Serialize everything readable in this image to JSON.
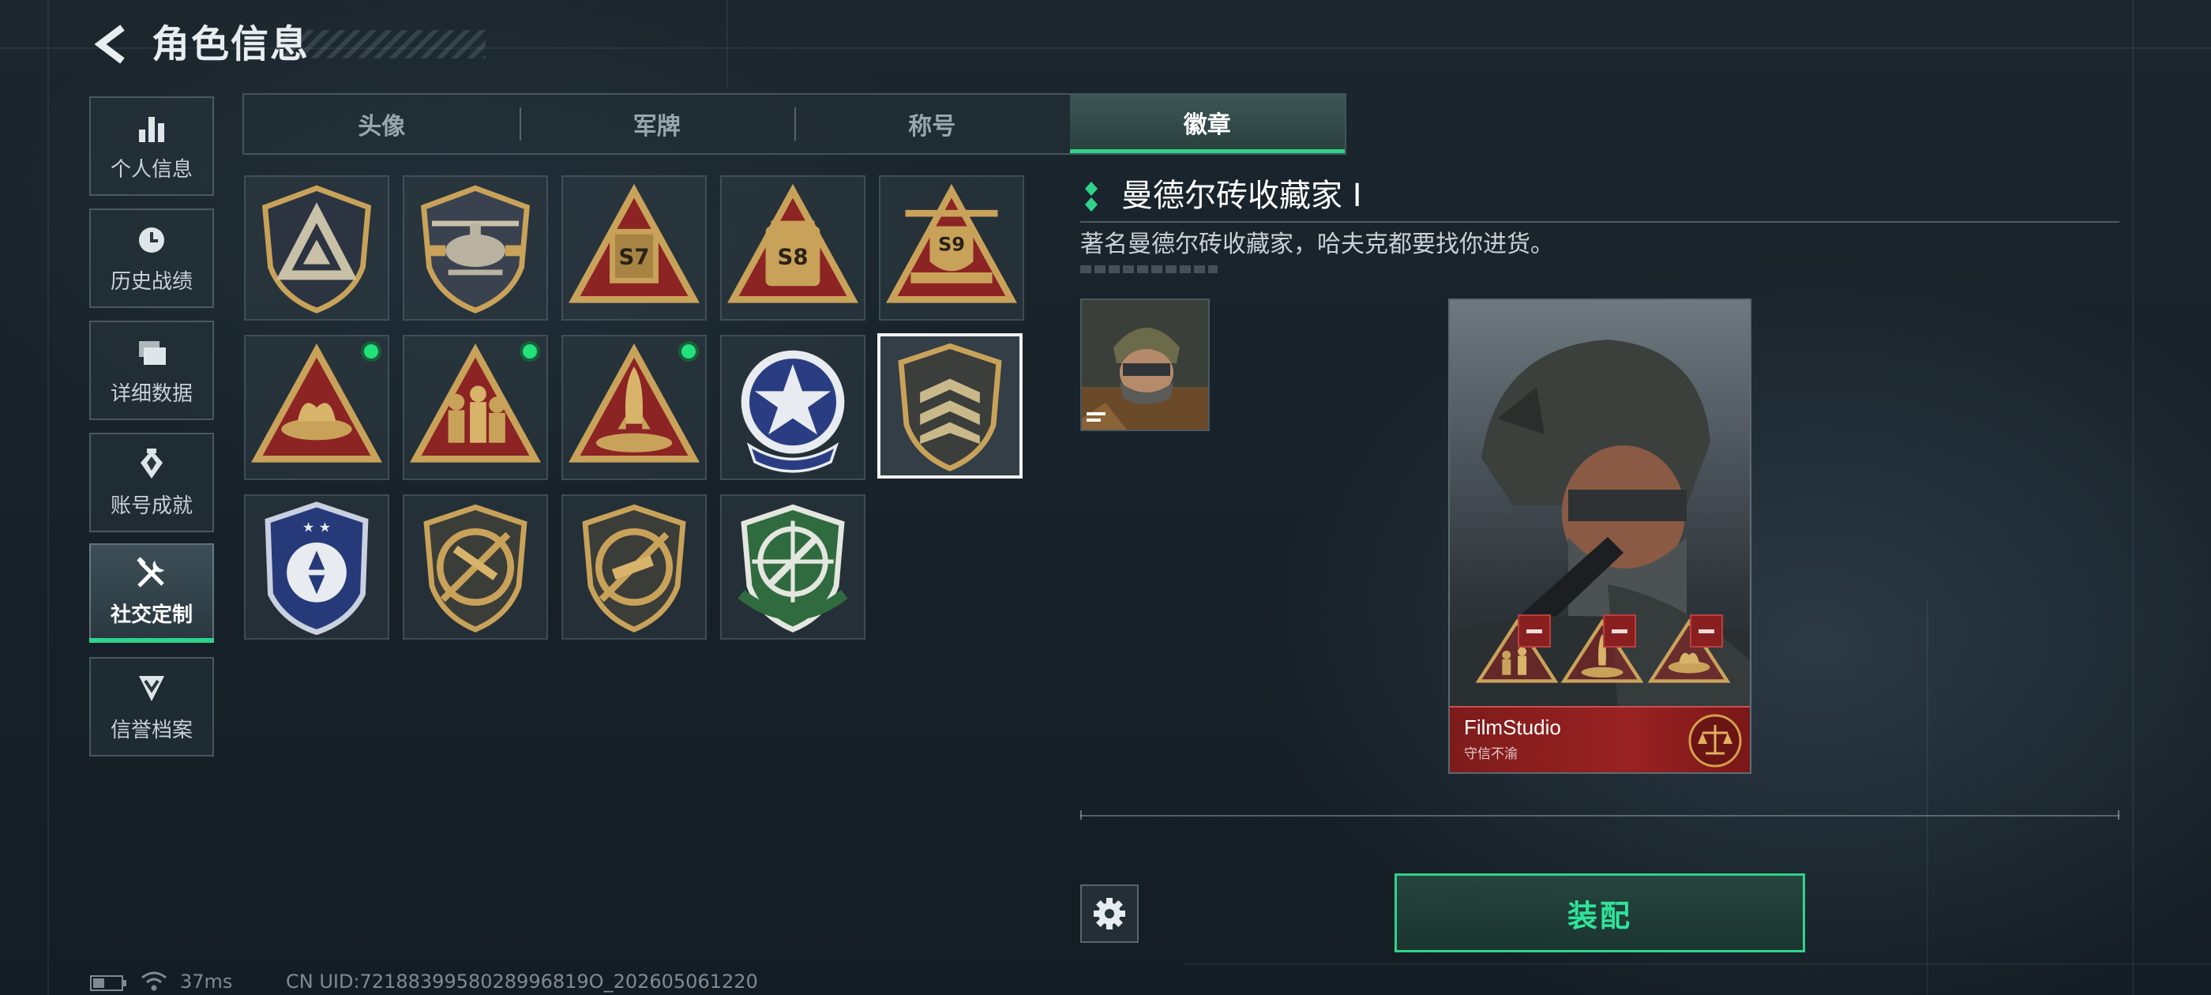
{
  "header": {
    "title": "角色信息"
  },
  "sidebar": {
    "items": [
      {
        "label": "个人信息",
        "icon": "bar-chart-icon"
      },
      {
        "label": "历史战绩",
        "icon": "clock-icon"
      },
      {
        "label": "详细数据",
        "icon": "folder-icon"
      },
      {
        "label": "账号成就",
        "icon": "achievement-icon"
      },
      {
        "label": "社交定制",
        "icon": "tools-icon",
        "active": true
      },
      {
        "label": "信誉档案",
        "icon": "shield-chevron-icon"
      }
    ]
  },
  "tabs": [
    {
      "label": "头像"
    },
    {
      "label": "军牌"
    },
    {
      "label": "称号"
    },
    {
      "label": "徽章",
      "active": true
    }
  ],
  "badges": [
    {
      "name": "delta-shield-badge",
      "text": ""
    },
    {
      "name": "helicopter-badge",
      "text": ""
    },
    {
      "name": "s7-badge",
      "text": "S7"
    },
    {
      "name": "s8-badge",
      "text": "S8"
    },
    {
      "name": "s9-badge",
      "text": "S9"
    },
    {
      "name": "bricks-badge",
      "text": "",
      "new": true
    },
    {
      "name": "soldiers-badge",
      "text": "",
      "new": true
    },
    {
      "name": "rocket-badge",
      "text": "",
      "new": true
    },
    {
      "name": "star-wreath-badge",
      "text": ""
    },
    {
      "name": "chevron-shield-badge",
      "text": "",
      "selected": true
    },
    {
      "name": "blue-police-badge",
      "text": ""
    },
    {
      "name": "rifle-badge",
      "text": ""
    },
    {
      "name": "smg-badge",
      "text": ""
    },
    {
      "name": "green-scope-badge",
      "text": ""
    }
  ],
  "detail": {
    "title": "曼德尔砖收藏家 I",
    "description": "著名曼德尔砖收藏家，哈夫克都要找你进货。"
  },
  "card": {
    "name": "FilmStudio",
    "motto": "守信不渝"
  },
  "actions": {
    "equip": "装配"
  },
  "status": {
    "ping": "37ms",
    "uid": "CN UID:7218839958028996819O_202605061220"
  },
  "colors": {
    "accent": "#2fd48a",
    "gold": "#c9a25a",
    "card_red": "#9a2222"
  }
}
